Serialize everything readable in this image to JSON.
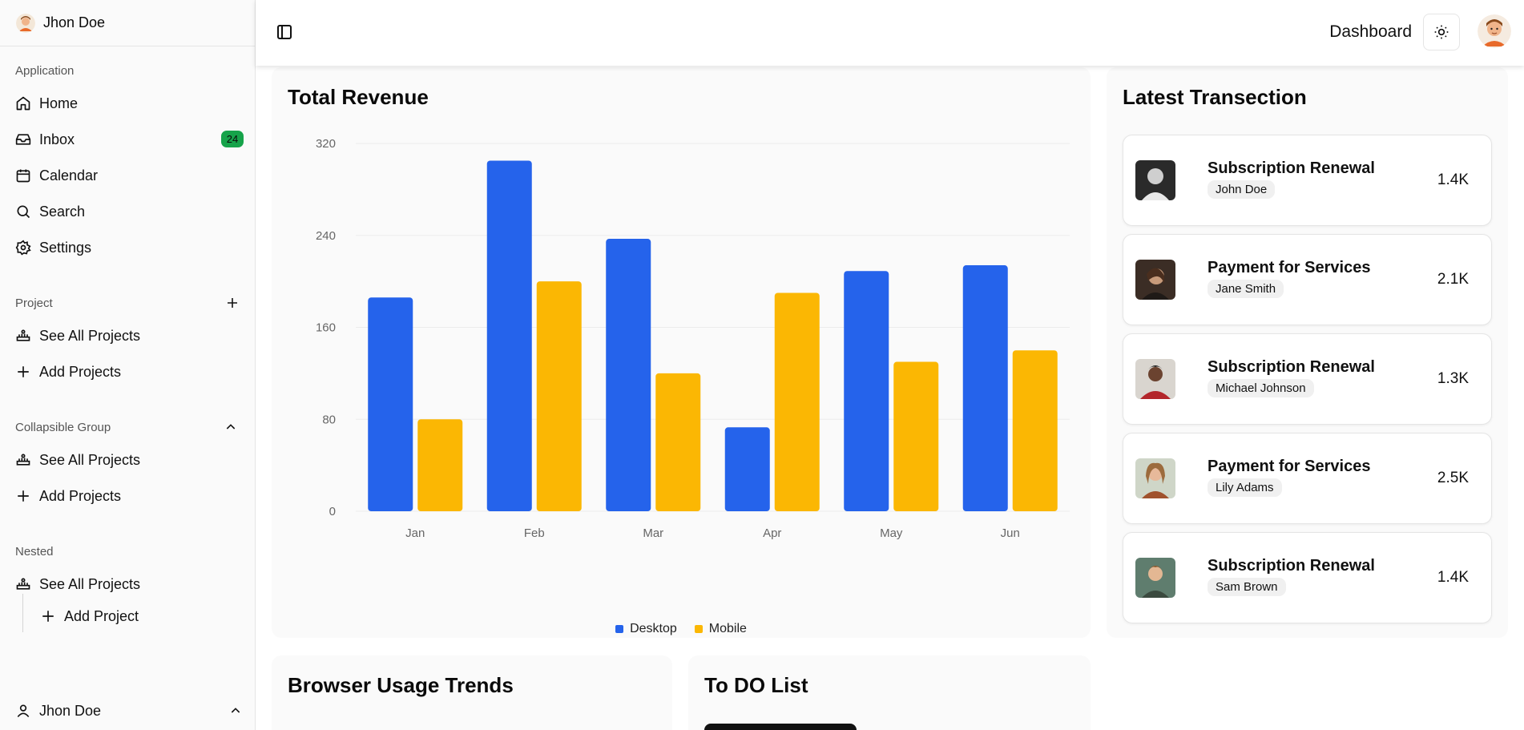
{
  "sidebar": {
    "user_top": "Jhon Doe",
    "group_application": "Application",
    "items": [
      {
        "label": "Home",
        "icon": "home-icon"
      },
      {
        "label": "Inbox",
        "icon": "inbox-icon",
        "badge": "24"
      },
      {
        "label": "Calendar",
        "icon": "calendar-icon"
      },
      {
        "label": "Search",
        "icon": "search-icon"
      },
      {
        "label": "Settings",
        "icon": "settings-icon"
      }
    ],
    "group_project": "Project",
    "project_items": [
      {
        "label": "See All Projects",
        "icon": "projects-icon"
      },
      {
        "label": "Add Projects",
        "icon": "plus-icon"
      }
    ],
    "group_collapsible": "Collapsible Group",
    "collapsible_items": [
      {
        "label": "See All Projects",
        "icon": "projects-icon"
      },
      {
        "label": "Add Projects",
        "icon": "plus-icon"
      }
    ],
    "group_nested": "Nested",
    "nested_items": [
      {
        "label": "See All Projects",
        "icon": "projects-icon"
      },
      {
        "label": "Add Project",
        "icon": "plus-icon"
      }
    ],
    "user_bottom": "Jhon Doe",
    "badge_color": "#16a34a"
  },
  "header": {
    "title": "Dashboard"
  },
  "revenue": {
    "title": "Total Revenue"
  },
  "chart_data": {
    "type": "bar",
    "title": "Total Revenue",
    "categories": [
      "Jan",
      "Feb",
      "Mar",
      "Apr",
      "May",
      "Jun"
    ],
    "series": [
      {
        "name": "Desktop",
        "values": [
          186,
          305,
          237,
          73,
          209,
          214
        ],
        "color": "#2563eb"
      },
      {
        "name": "Mobile",
        "values": [
          80,
          200,
          120,
          190,
          130,
          140
        ],
        "color": "#fbb703"
      }
    ],
    "yticks": [
      0,
      80,
      160,
      240,
      320
    ],
    "ylim": [
      0,
      320
    ],
    "grid": true,
    "legend": "bottom"
  },
  "transactions": {
    "title": "Latest Transection",
    "items": [
      {
        "title": "Subscription Renewal",
        "name": "John Doe",
        "amount": "1.4K"
      },
      {
        "title": "Payment for Services",
        "name": "Jane Smith",
        "amount": "2.1K"
      },
      {
        "title": "Subscription Renewal",
        "name": "Michael Johnson",
        "amount": "1.3K"
      },
      {
        "title": "Payment for Services",
        "name": "Lily Adams",
        "amount": "2.5K"
      },
      {
        "title": "Subscription Renewal",
        "name": "Sam Brown",
        "amount": "1.4K"
      }
    ]
  },
  "browser": {
    "title": "Browser Usage Trends"
  },
  "todo": {
    "title": "To DO List"
  }
}
